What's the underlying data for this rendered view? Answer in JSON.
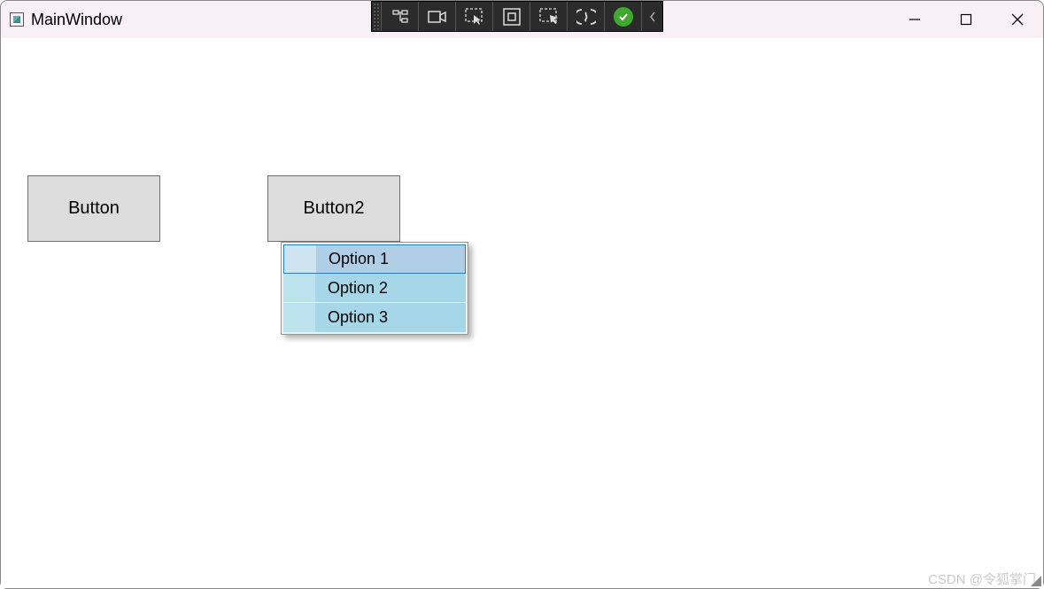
{
  "window": {
    "title": "MainWindow"
  },
  "buttons": {
    "button1": "Button",
    "button2": "Button2"
  },
  "contextMenu": {
    "options": [
      "Option 1",
      "Option 2",
      "Option 3"
    ]
  },
  "watermark": "CSDN @令狐掌门"
}
